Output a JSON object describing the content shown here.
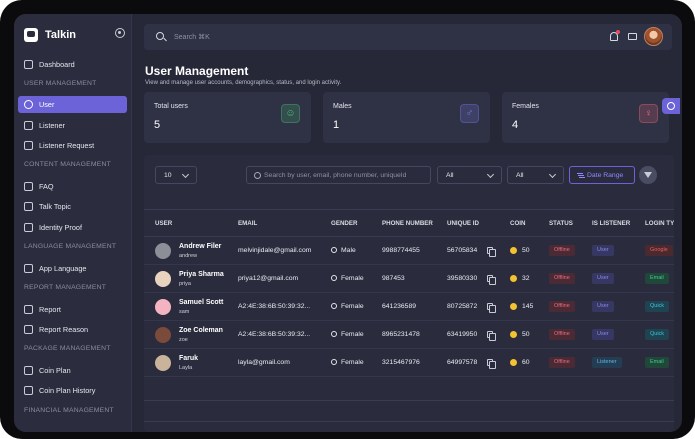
{
  "app": {
    "name": "Talkin"
  },
  "sidebar": {
    "items": [
      {
        "label": "Dashboard"
      },
      {
        "section": "USER MANAGEMENT"
      },
      {
        "label": "User"
      },
      {
        "label": "Listener"
      },
      {
        "label": "Listener Request"
      },
      {
        "section": "CONTENT MANAGEMENT"
      },
      {
        "label": "FAQ"
      },
      {
        "label": "Talk Topic"
      },
      {
        "label": "Identity Proof"
      },
      {
        "section": "LANGUAGE MANAGEMENT"
      },
      {
        "label": "App Language"
      },
      {
        "section": "REPORT MANAGEMENT"
      },
      {
        "label": "Report"
      },
      {
        "label": "Report Reason"
      },
      {
        "section": "PACKAGE MANAGEMENT"
      },
      {
        "label": "Coin Plan"
      },
      {
        "label": "Coin Plan History"
      },
      {
        "section": "FINANCIAL MANAGEMENT"
      }
    ],
    "active": "User"
  },
  "topbar": {
    "search_placeholder": "Search ⌘K"
  },
  "page": {
    "title": "User Management",
    "subtitle": "View and manage user accounts, demographics, status, and login activity."
  },
  "stats": [
    {
      "label": "Total users",
      "value": "5",
      "icon": "user-icon",
      "color": "#4cc17a"
    },
    {
      "label": "Males",
      "value": "1",
      "icon": "male-icon",
      "color": "#7c7cf0"
    },
    {
      "label": "Females",
      "value": "4",
      "icon": "female-icon",
      "color": "#f06a7b"
    }
  ],
  "controls": {
    "page_size": "10",
    "search_placeholder": "Search by user, email, phone number, uniqueId",
    "filter1": "All",
    "filter2": "All",
    "date_range": "Date Range"
  },
  "table": {
    "columns": [
      "USER",
      "EMAIL",
      "GENDER",
      "PHONE NUMBER",
      "UNIQUE ID",
      "COIN",
      "STATUS",
      "IS LISTENER",
      "LOGIN TY"
    ],
    "rows": [
      {
        "name": "Andrew Filer",
        "username": "andrew",
        "email": "melvinjidale@gmail.com",
        "gender": "Male",
        "phone": "9988774455",
        "unique_id": "56705834",
        "coin": "50",
        "status": "Offline",
        "listener": "User",
        "login": "Google",
        "login_kind": "google",
        "avatar_color": "#8d8f98"
      },
      {
        "name": "Priya Sharma",
        "username": "priya",
        "email": "priya12@gmail.com",
        "gender": "Female",
        "phone": "987453",
        "unique_id": "39580330",
        "coin": "32",
        "status": "Offline",
        "listener": "User",
        "login": "Email",
        "login_kind": "email",
        "avatar_color": "#e8d3bf"
      },
      {
        "name": "Samuel Scott",
        "username": "sam",
        "email": "A2:4E:38:6B:50:39:32...",
        "gender": "Female",
        "phone": "641236589",
        "unique_id": "80725872",
        "coin": "145",
        "status": "Offline",
        "listener": "User",
        "login": "Quick",
        "login_kind": "quick",
        "avatar_color": "#f3b3c0"
      },
      {
        "name": "Zoe Coleman",
        "username": "zoe",
        "email": "A2:4E:38:6B:50:39:32...",
        "gender": "Female",
        "phone": "8965231478",
        "unique_id": "63419950",
        "coin": "50",
        "status": "Offline",
        "listener": "User",
        "login": "Quick",
        "login_kind": "quick",
        "avatar_color": "#7a4a3a"
      },
      {
        "name": "Faruk",
        "username": "Layla",
        "email": "layla@gmail.com",
        "gender": "Female",
        "phone": "3215467976",
        "unique_id": "64997578",
        "coin": "60",
        "status": "Offline",
        "listener": "Listener",
        "login": "Email",
        "login_kind": "email",
        "avatar_color": "#c9b39a"
      }
    ]
  }
}
